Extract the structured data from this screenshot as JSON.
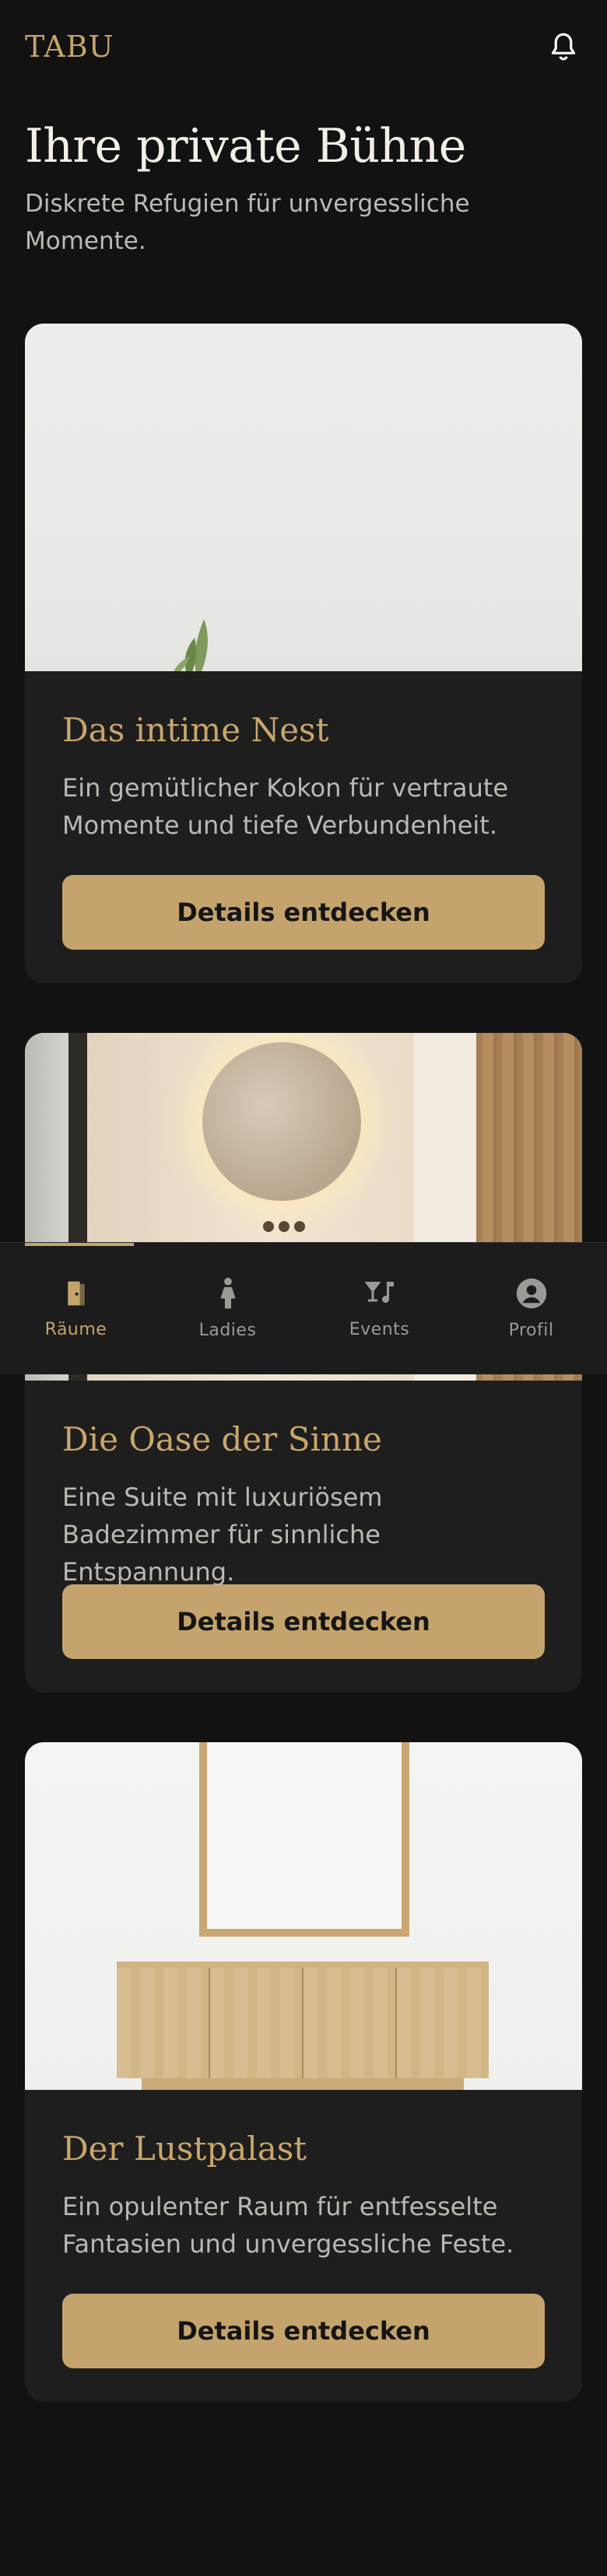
{
  "app": {
    "logo": "TABU"
  },
  "header": {
    "bell_icon": "bell-icon"
  },
  "hero": {
    "title": "Ihre private Bühne",
    "subtitle": "Diskrete Refugien für unvergessliche Momente."
  },
  "rooms": [
    {
      "title": "Das intime Nest",
      "description": "Ein gemütlicher Kokon für vertraute Momente und tiefe Verbundenheit.",
      "button": "Details entdecken"
    },
    {
      "title": "Die Oase der Sinne",
      "description": "Eine Suite mit luxuriösem Badezimmer für sinnliche Entspannung.",
      "button": "Details entdecken"
    },
    {
      "title": "Der Lustpalast",
      "description": "Ein opulenter Raum für entfesselte Fantasien und unvergessliche Feste.",
      "button": "Details entdecken"
    }
  ],
  "nav": {
    "items": [
      {
        "label": "Räume",
        "icon": "door-icon",
        "active": true
      },
      {
        "label": "Ladies",
        "icon": "woman-icon",
        "active": false
      },
      {
        "label": "Events",
        "icon": "cocktail-music-icon",
        "active": false
      },
      {
        "label": "Profil",
        "icon": "user-icon",
        "active": false
      }
    ]
  },
  "colors": {
    "accent": "#c4a46c",
    "background": "#121212",
    "card": "#1e1e1e"
  }
}
